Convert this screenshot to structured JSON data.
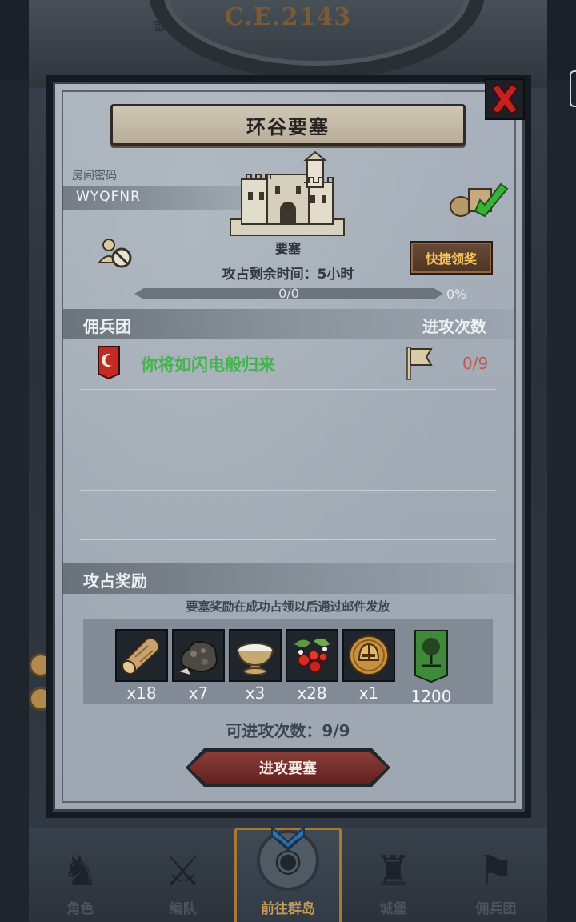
{
  "background": {
    "date": "C.E.2143",
    "top_tab_text": "雷鸣"
  },
  "dialog": {
    "title": "环谷要塞",
    "room_code_label": "房间密码",
    "room_code": "WYQFNR",
    "fortress_label": "要塞",
    "quick_claim_label": "快捷领奖",
    "attack_time": "攻占剩余时间：5小时",
    "progress": {
      "value": 0,
      "text": "0/0",
      "percent_text": "0%"
    },
    "mercenary_header": "佣兵团",
    "attack_count_header": "进攻次数",
    "mercenaries": [
      {
        "name": "你将如闪电般归来",
        "count": "0/9"
      }
    ],
    "rewards_header": "攻占奖励",
    "reward_note": "要塞奖励在成功占领以后通过邮件发放",
    "rewards": [
      {
        "icon": "wood-log-icon",
        "qty": "x18"
      },
      {
        "icon": "ore-icon",
        "qty": "x7"
      },
      {
        "icon": "bowl-icon",
        "qty": "x3"
      },
      {
        "icon": "berries-icon",
        "qty": "x28"
      },
      {
        "icon": "helmet-coin-icon",
        "qty": "x1"
      },
      {
        "icon": "tree-banner-icon",
        "qty": "1200"
      }
    ],
    "attack_count_text": "可进攻次数：9/9",
    "attack_button_label": "进攻要塞"
  },
  "bottom_nav": [
    {
      "label": "角色",
      "icon": "knight-icon"
    },
    {
      "label": "编队",
      "icon": "squad-icon"
    },
    {
      "label": "前往群岛",
      "icon": "islands-icon",
      "active": true
    },
    {
      "label": "城堡",
      "icon": "castle-icon"
    },
    {
      "label": "佣兵团",
      "icon": "mercenary-icon"
    }
  ],
  "colors": {
    "merc_name": "#3fb54a",
    "merc_count": "#c1574e",
    "quick_claim_text": "#f3c35e",
    "attack_button": "#7a2f2c"
  }
}
